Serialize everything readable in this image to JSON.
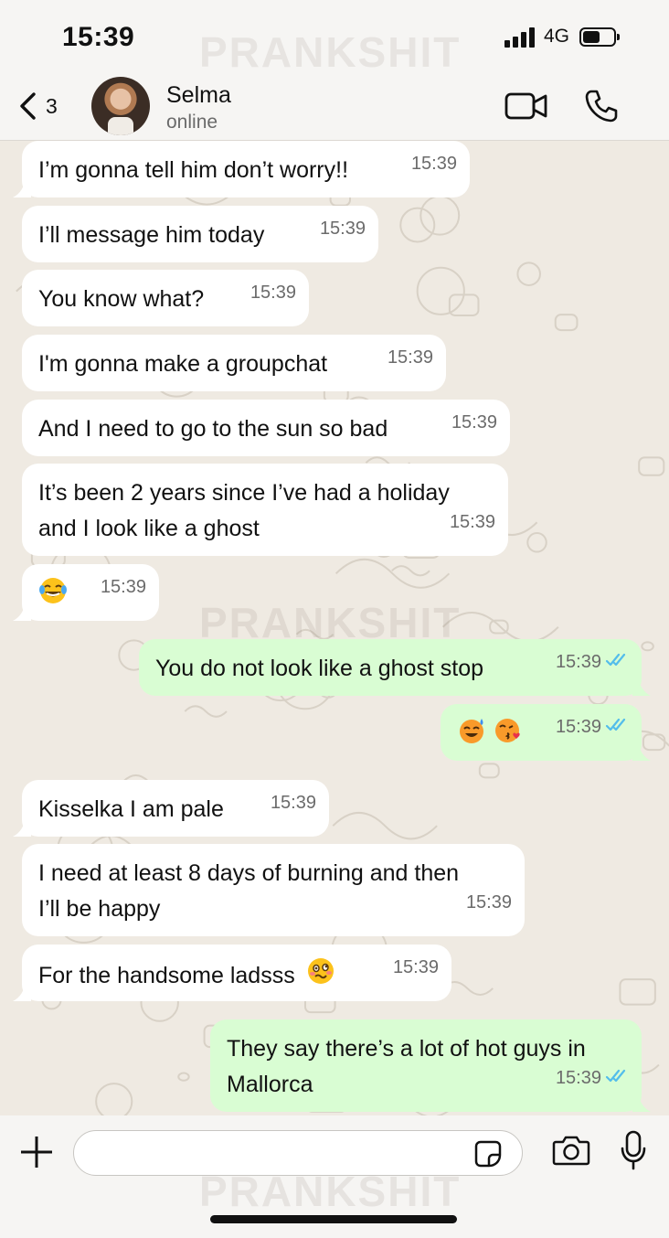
{
  "status_bar": {
    "time": "15:39",
    "network": "4G",
    "battery_level": 0.55
  },
  "watermark": "PRANKSHIT",
  "header": {
    "back_count": "3",
    "contact_name": "Selma",
    "contact_status": "online"
  },
  "colors": {
    "incoming_bubble": "#ffffff",
    "outgoing_bubble": "#d9fdd3",
    "read_ticks": "#53bdeb",
    "chat_background": "#efeae2"
  },
  "messages": [
    {
      "dir": "in",
      "lines": [
        "I’m gonna tell him don’t worry!!"
      ],
      "time": "15:39"
    },
    {
      "dir": "in",
      "lines": [
        "I’ll message him today"
      ],
      "time": "15:39"
    },
    {
      "dir": "in",
      "lines": [
        "You know what?"
      ],
      "time": "15:39"
    },
    {
      "dir": "in",
      "lines": [
        "I'm gonna make a groupchat"
      ],
      "time": "15:39"
    },
    {
      "dir": "in",
      "lines": [
        "And I need to go to the sun so bad"
      ],
      "time": "15:39"
    },
    {
      "dir": "in",
      "lines": [
        "It’s been 2 years since I’ve had a holiday",
        "and I look like a ghost"
      ],
      "time": "15:39"
    },
    {
      "dir": "in",
      "emoji": [
        "tears-of-joy-emoji"
      ],
      "time": "15:39"
    },
    {
      "dir": "out",
      "lines": [
        "You do not look like a ghost stop"
      ],
      "time": "15:39",
      "status": "read"
    },
    {
      "dir": "out",
      "emoji": [
        "smiling-sweat-emoji",
        "blowing-kiss-emoji"
      ],
      "time": "15:39",
      "status": "read"
    },
    {
      "dir": "in",
      "lines": [
        "Kisselka I am pale"
      ],
      "time": "15:39"
    },
    {
      "dir": "in",
      "lines": [
        "I need at least 8 days of burning and then",
        "I’ll be happy"
      ],
      "time": "15:39"
    },
    {
      "dir": "in",
      "lines": [
        "For the handsome ladsss"
      ],
      "emoji_after": "woozy-face-emoji",
      "time": "15:39"
    },
    {
      "dir": "out",
      "lines": [
        "They say there’s a lot of hot guys in",
        "Mallorca"
      ],
      "time": "15:39",
      "status": "read"
    }
  ],
  "input": {
    "value": "",
    "placeholder": ""
  }
}
